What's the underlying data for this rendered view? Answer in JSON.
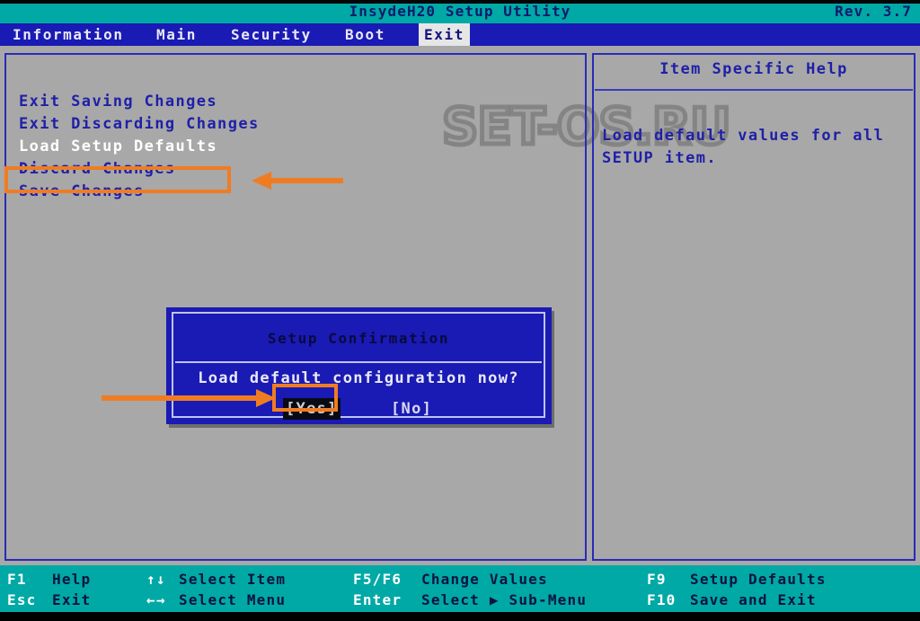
{
  "titlebar": {
    "app_title": "InsydeH20 Setup Utility",
    "revision": "Rev. 3.7"
  },
  "menubar": {
    "items": [
      {
        "label": "Information",
        "active": false
      },
      {
        "label": "Main",
        "active": false
      },
      {
        "label": "Security",
        "active": false
      },
      {
        "label": "Boot",
        "active": false
      },
      {
        "label": "Exit",
        "active": true
      }
    ]
  },
  "watermark": {
    "text": "SET-OS.RU"
  },
  "left_panel": {
    "options": [
      {
        "label": "Exit Saving Changes",
        "selected": false
      },
      {
        "label": "Exit Discarding Changes",
        "selected": false
      },
      {
        "label": "Load Setup Defaults",
        "selected": true
      },
      {
        "label": "Discard Changes",
        "selected": false
      },
      {
        "label": "Save Changes",
        "selected": false
      }
    ]
  },
  "help_panel": {
    "title": "Item Specific Help",
    "text": "Load default values for all\nSETUP item."
  },
  "dialog": {
    "title": "Setup Confirmation",
    "message": "Load default configuration now?",
    "yes_label": "[Yes]",
    "no_label": "[No]",
    "selected": "yes"
  },
  "statusbar": {
    "columns": [
      {
        "rows": [
          {
            "key": "F1",
            "desc": "Help"
          },
          {
            "key": "Esc",
            "desc": "Exit"
          }
        ]
      },
      {
        "rows": [
          {
            "key": "↑↓",
            "desc": "Select Item"
          },
          {
            "key": "←→",
            "desc": "Select Menu"
          }
        ]
      },
      {
        "rows": [
          {
            "key": "F5/F6",
            "desc": "Change Values"
          },
          {
            "key": "Enter",
            "desc": "Select ▶ Sub-Menu"
          }
        ]
      },
      {
        "rows": [
          {
            "key": "F9",
            "desc": "Setup Defaults"
          },
          {
            "key": "F10",
            "desc": "Save and Exit"
          }
        ]
      }
    ]
  },
  "annotations": {
    "accent_color": "#f07c22",
    "highlight_option": "Load Setup Defaults",
    "highlight_button": "[Yes]"
  },
  "colors": {
    "title_bar": "#00a9a5",
    "menu_bar": "#1a1ab4",
    "body": "#a8a8a8",
    "panel_border": "#2a2ab8",
    "dialog_bg": "#1a1ab4",
    "text_blue": "#1f1fa8",
    "accent_orange": "#f07c22"
  }
}
